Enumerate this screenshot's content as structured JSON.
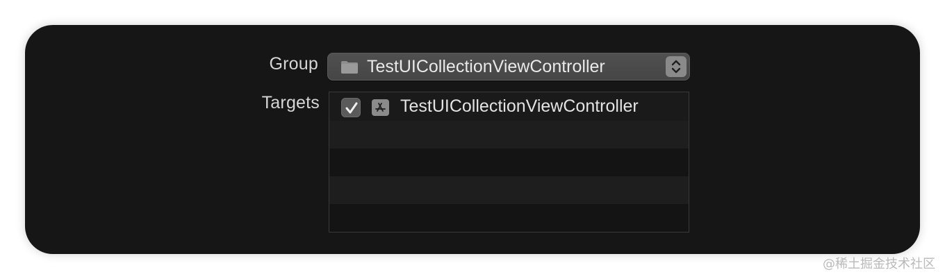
{
  "form": {
    "group_label": "Group",
    "targets_label": "Targets"
  },
  "group_popup": {
    "icon": "folder-icon",
    "value": "TestUICollectionViewController",
    "stepper_icon": "up-down-chevron-icon"
  },
  "targets": {
    "items": [
      {
        "checked": true,
        "icon": "app-store-icon",
        "name": "TestUICollectionViewController"
      }
    ],
    "empty_rows": 4
  },
  "watermark": "@稀土掘金技术社区",
  "colors": {
    "panel_background": "#161616",
    "popup_background": "#4a4a4a",
    "text": "#e3e3e3",
    "label_text": "#d6d6d6"
  }
}
